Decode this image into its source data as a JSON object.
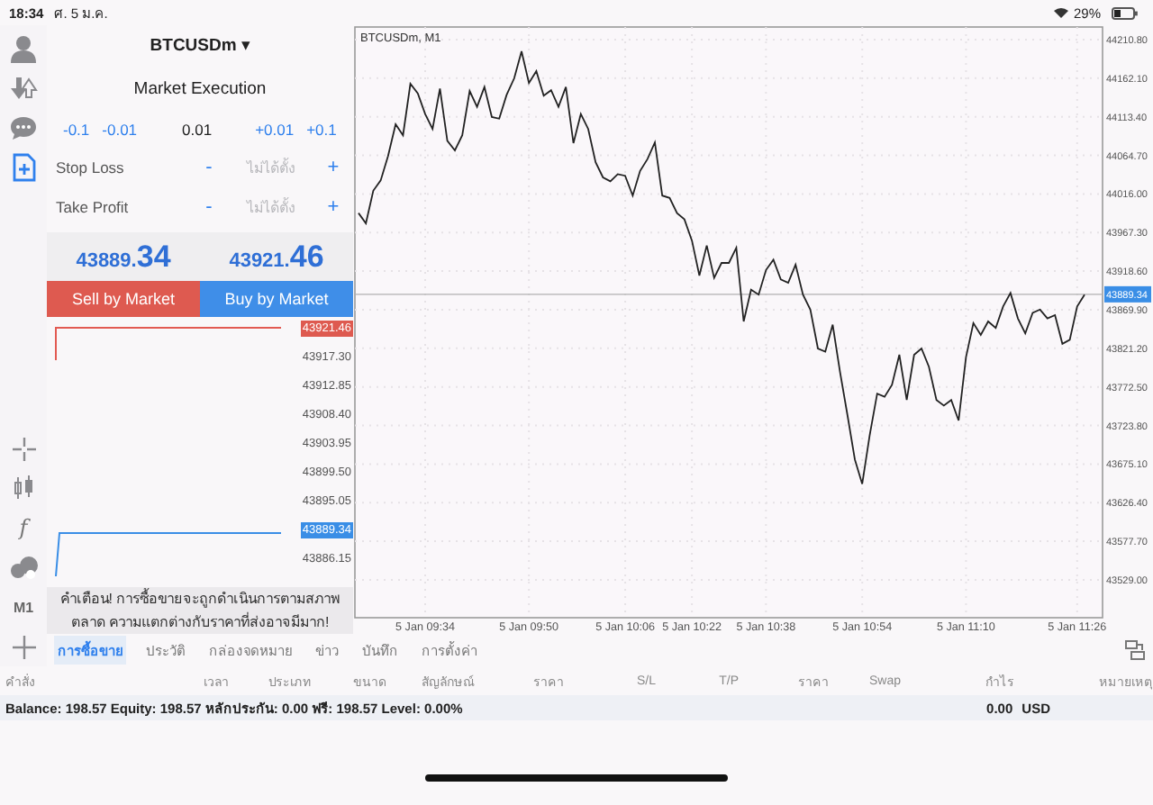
{
  "status_bar": {
    "time": "18:34",
    "date": "ศ. 5 ม.ค.",
    "battery": "29%"
  },
  "left_toolbar": {
    "top": [
      {
        "kind": "account",
        "selected": false
      },
      {
        "kind": "trade",
        "selected": false
      },
      {
        "kind": "chat",
        "selected": false
      },
      {
        "kind": "new-order",
        "selected": true
      }
    ],
    "bottom": [
      {
        "kind": "crosshair"
      },
      {
        "kind": "candles"
      },
      {
        "kind": "function",
        "label": "f"
      },
      {
        "kind": "objects"
      },
      {
        "kind": "timeframe",
        "label": "M1"
      },
      {
        "kind": "add"
      }
    ]
  },
  "order": {
    "symbol": "BTCUSDm",
    "symbol_caret": "▾",
    "execution": "Market Execution",
    "volume": {
      "steps_down": [
        "-0.1",
        "-0.01"
      ],
      "value": "0.01",
      "steps_up": [
        "+0.01",
        "+0.1"
      ]
    },
    "levels": [
      {
        "label": "Stop Loss",
        "minus": "-",
        "placeholder": "ไม่ได้ตั้ง",
        "plus": "+"
      },
      {
        "label": "Take Profit",
        "minus": "-",
        "placeholder": "ไม่ได้ตั้ง",
        "plus": "+"
      }
    ],
    "bid": {
      "main": "43889.",
      "pips": "34"
    },
    "ask": {
      "main": "43921.",
      "pips": "46"
    },
    "sell_button": "Sell by Market",
    "buy_button": "Buy by Market",
    "ticks": [
      {
        "price": "43921.46",
        "kind": "ask"
      },
      {
        "price": "43917.30",
        "kind": "level"
      },
      {
        "price": "43912.85",
        "kind": "level"
      },
      {
        "price": "43908.40",
        "kind": "level"
      },
      {
        "price": "43903.95",
        "kind": "level"
      },
      {
        "price": "43899.50",
        "kind": "level"
      },
      {
        "price": "43895.05",
        "kind": "level"
      },
      {
        "price": "43889.34",
        "kind": "bid"
      },
      {
        "price": "43886.15",
        "kind": "level"
      }
    ],
    "warning": "คำเตือน! การซื้อขายจะถูกดำเนินการตามสภาพตลาด ความแตกต่างกับราคาที่ส่งอาจมีมาก!"
  },
  "chart": {
    "label": "BTCUSDm, M1",
    "chart_data": {
      "type": "line",
      "grid": true,
      "ref_lines": [
        {
          "axis": "y",
          "value": 43889.34,
          "label": "43889.34"
        }
      ],
      "ylim": [
        43481.2,
        44226.7
      ],
      "categories": [
        null,
        null,
        null,
        null,
        null,
        null,
        null,
        null,
        null,
        "5 Jan 09:34",
        null,
        null,
        null,
        null,
        null,
        null,
        null,
        null,
        null,
        null,
        null,
        null,
        null,
        "5 Jan 09:50",
        null,
        null,
        null,
        null,
        null,
        null,
        null,
        null,
        null,
        null,
        null,
        null,
        "5 Jan 10:06",
        null,
        null,
        null,
        null,
        null,
        null,
        null,
        null,
        "5 Jan 10:22",
        null,
        null,
        null,
        null,
        null,
        null,
        null,
        null,
        null,
        "5 Jan 10:38",
        null,
        null,
        null,
        null,
        null,
        null,
        null,
        null,
        null,
        null,
        null,
        null,
        "5 Jan 10:54",
        null,
        null,
        null,
        null,
        null,
        null,
        null,
        null,
        null,
        null,
        null,
        null,
        null,
        "5 Jan 11:10",
        null,
        null,
        null,
        null,
        null,
        null,
        null,
        null,
        null,
        null,
        null,
        null,
        null,
        null,
        "5 Jan 11:26",
        null
      ],
      "yticks": [
        {
          "value": 44210.8,
          "label": "44210.80"
        },
        {
          "value": 44162.1,
          "label": "44162.10"
        },
        {
          "value": 44113.4,
          "label": "44113.40"
        },
        {
          "value": 44064.7,
          "label": "44064.70"
        },
        {
          "value": 44016,
          "label": "44016.00"
        },
        {
          "value": 43967.3,
          "label": "43967.30"
        },
        {
          "value": 43918.6,
          "label": "43918.60"
        },
        {
          "value": 43869.9,
          "label": "43869.90"
        },
        {
          "value": 43821.2,
          "label": "43821.20"
        },
        {
          "value": 43772.5,
          "label": "43772.50"
        },
        {
          "value": 43723.8,
          "label": "43723.80"
        },
        {
          "value": 43675.1,
          "label": "43675.10"
        },
        {
          "value": 43626.4,
          "label": "43626.40"
        },
        {
          "value": 43577.7,
          "label": "43577.70"
        },
        {
          "value": 43529,
          "label": "43529.00"
        }
      ],
      "series": [
        {
          "color": "#222222",
          "values": [
            43992,
            43979,
            44020,
            44033,
            44064,
            44104,
            44090,
            44155,
            44143,
            44117,
            44098,
            44149,
            44083,
            44071,
            44090,
            44146,
            44126,
            44151,
            44113,
            44111,
            44141,
            44162,
            44196,
            44156,
            44171,
            44140,
            44147,
            44126,
            44151,
            44080,
            44117,
            44098,
            44056,
            44037,
            44032,
            44041,
            44039,
            44014,
            44045,
            44060,
            44081,
            44014,
            44011,
            43992,
            43984,
            43957,
            43913,
            43951,
            43910,
            43929,
            43929,
            43948,
            43855,
            43895,
            43889,
            43920,
            43933,
            43908,
            43904,
            43927,
            43889,
            43870,
            43821,
            43817,
            43851,
            43791,
            43737,
            43681,
            43650,
            43711,
            43764,
            43760,
            43775,
            43813,
            43756,
            43813,
            43821,
            43798,
            43756,
            43749,
            43756,
            43730,
            43810,
            43853,
            43838,
            43855,
            43847,
            43874,
            43891,
            43859,
            43840,
            43866,
            43870,
            43859,
            43863,
            43827,
            43832,
            43874,
            43889
          ]
        }
      ]
    }
  },
  "terminal": {
    "tabs": [
      {
        "label": "การซื้อขาย",
        "selected": true
      },
      {
        "label": "ประวัติ",
        "selected": false
      },
      {
        "label": "กล่องจดหมาย",
        "selected": false
      },
      {
        "label": "ข่าว",
        "selected": false
      },
      {
        "label": "บันทึก",
        "selected": false
      },
      {
        "label": "การตั้งค่า",
        "selected": false
      }
    ],
    "columns": [
      "คำสั่ง",
      "เวลา",
      "ประเภท",
      "ขนาด",
      "สัญลักษณ์",
      "ราคา",
      "S/L",
      "T/P",
      "ราคา",
      "Swap",
      "กำไร",
      "หมายเหตุ"
    ],
    "summary": "Balance: 198.57 Equity: 198.57 หลักประกัน: 0.00 ฟรี: 198.57 Level: 0.00%",
    "profit": "0.00",
    "currency": "USD"
  }
}
